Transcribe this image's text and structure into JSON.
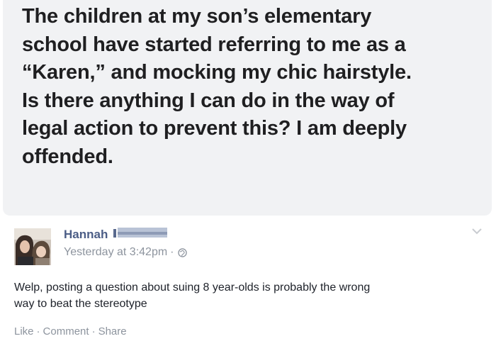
{
  "post": {
    "lines": [
      "The children at my son’s elementary",
      "school have started referring to me as a",
      "“Karen,” and mocking my chic hairstyle.",
      "Is there anything I can do in the way of",
      "legal action to prevent this? I am deeply",
      "offended."
    ]
  },
  "comment": {
    "author": "Hannah",
    "timestamp": "Yesterday at 3:42pm",
    "separator": "·",
    "privacy_icon": "globe-icon",
    "text_lines": [
      "Welp, posting a question about suing 8 year-olds is probably the wrong",
      "way to beat the stereotype"
    ],
    "actions": {
      "like": "Like",
      "comment": "Comment",
      "share": "Share"
    }
  },
  "colors": {
    "bubble_bg": "#f1f2f4",
    "post_text": "#1f1f21",
    "author_name": "#4b5d86",
    "meta_text": "#8d949e",
    "comment_text": "#1d2129"
  }
}
